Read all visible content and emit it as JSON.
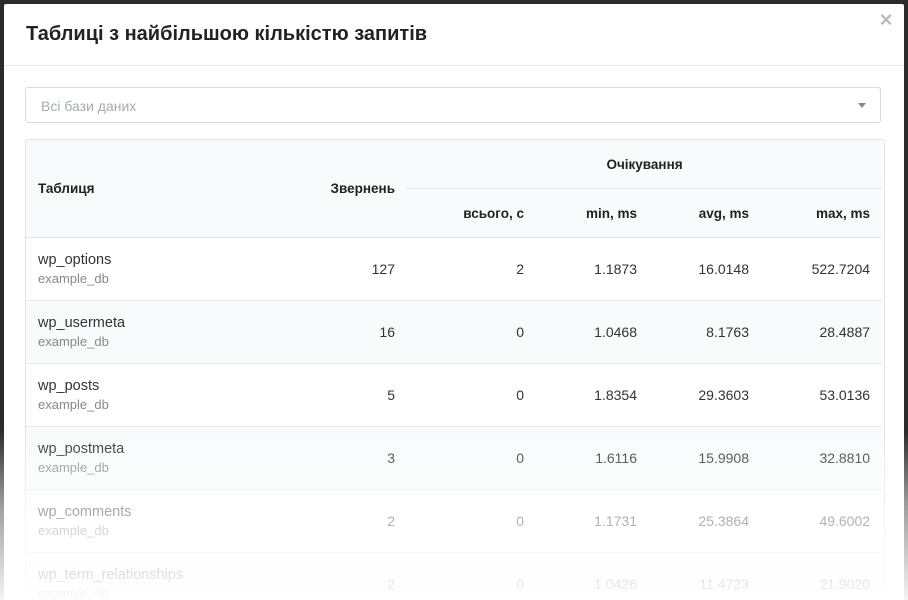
{
  "modal": {
    "title": "Таблиці з найбільшою кількістю запитів",
    "close_label": "×"
  },
  "filter": {
    "placeholder": "Всі бази даних"
  },
  "table": {
    "headers": {
      "table": "Таблиця",
      "calls": "Звернень",
      "wait": "Очікування",
      "total": "всього, с",
      "min": "min, ms",
      "avg": "avg, ms",
      "max": "max, ms"
    },
    "rows": [
      {
        "name": "wp_options",
        "db": "example_db",
        "calls": "127",
        "total": "2",
        "min": "1.1873",
        "avg": "16.0148",
        "max": "522.7204"
      },
      {
        "name": "wp_usermeta",
        "db": "example_db",
        "calls": "16",
        "total": "0",
        "min": "1.0468",
        "avg": "8.1763",
        "max": "28.4887"
      },
      {
        "name": "wp_posts",
        "db": "example_db",
        "calls": "5",
        "total": "0",
        "min": "1.8354",
        "avg": "29.3603",
        "max": "53.0136"
      },
      {
        "name": "wp_postmeta",
        "db": "example_db",
        "calls": "3",
        "total": "0",
        "min": "1.6116",
        "avg": "15.9908",
        "max": "32.8810"
      },
      {
        "name": "wp_comments",
        "db": "example_db",
        "calls": "2",
        "total": "0",
        "min": "1.1731",
        "avg": "25.3864",
        "max": "49.6002"
      },
      {
        "name": "wp_term_relationships",
        "db": "example_db",
        "calls": "2",
        "total": "0",
        "min": "1.0426",
        "avg": "11.4723",
        "max": "21.9020"
      }
    ]
  }
}
